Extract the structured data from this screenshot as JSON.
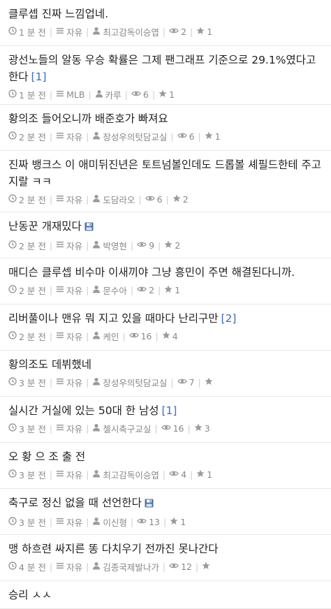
{
  "posts": [
    {
      "title": "클루셉 진짜 느낌업네.",
      "comments": "",
      "saved": false,
      "time": "1 분 전",
      "board": "자유",
      "author": "최고감독이승엽",
      "views": "2",
      "votes": "1",
      "h": 66
    },
    {
      "title": "광선노들의 알동 우승 확률은 그제 팬그래프 기준으로 29.1%였다고 한다",
      "comments": "[1]",
      "saved": false,
      "time": "1 분 전",
      "board": "MLB",
      "author": "카루",
      "views": "6",
      "votes": "1",
      "h": 84
    },
    {
      "title": "황의조 들어오니까 배준호가 빠져요",
      "comments": "",
      "saved": false,
      "time": "2 분 전",
      "board": "자유",
      "author": "장성우의텃담교실",
      "views": "6",
      "votes": "1",
      "h": 66
    },
    {
      "title": "진짜 뱅크스 이 애미뒤진년은 토트넘볼인데도 드롭볼 셰필드한테 주고 지랄 ㅋㅋ",
      "comments": "",
      "saved": false,
      "time": "2 분 전",
      "board": "자유",
      "author": "도담라오",
      "views": "6",
      "votes": "2",
      "h": 88
    },
    {
      "title": "난동꾼 개재밌다",
      "comments": "",
      "saved": true,
      "time": "2 분 전",
      "board": "자유",
      "author": "박영현",
      "views": "9",
      "votes": "2",
      "h": 66
    },
    {
      "title": "매디슨 클루셉 비수마 이새끼야 그냥 흥민이 주면 해결된다니까.",
      "comments": "",
      "saved": false,
      "time": "2 분 전",
      "board": "자유",
      "author": "문수아",
      "views": "2",
      "votes": "1",
      "h": 66
    },
    {
      "title": "리버풀이나 맨유 뭐 지고 있을 때마다 난리구만",
      "comments": "[2]",
      "saved": false,
      "time": "2 분 전",
      "board": "자유",
      "author": "케인",
      "views": "16",
      "votes": "4",
      "h": 66
    },
    {
      "title": "황의조도 데뷔했네",
      "comments": "",
      "saved": false,
      "time": "3 분 전",
      "board": "자유",
      "author": "장성우의텃담교실",
      "views": "7",
      "votes": "",
      "h": 66
    },
    {
      "title": "실시간 거실에 있는 50대 한 남성",
      "comments": "[1]",
      "saved": false,
      "time": "3 분 전",
      "board": "자유",
      "author": "첼시축구교실",
      "views": "16",
      "votes": "3",
      "h": 66
    },
    {
      "title": "오 황 으 조 출 전",
      "comments": "",
      "saved": false,
      "time": "3 분 전",
      "board": "자유",
      "author": "최고감독이승엽",
      "views": "4",
      "votes": "1",
      "h": 66
    },
    {
      "title": "축구로 정신 없을 때 선언한다",
      "comments": "",
      "saved": true,
      "time": "3 분 전",
      "board": "자유",
      "author": "이신형",
      "views": "13",
      "votes": "1",
      "h": 66
    },
    {
      "title": "맹 하흐련 싸지른 똥 다치우기 전까진 못나간다",
      "comments": "",
      "saved": false,
      "time": "4 분 전",
      "board": "자유",
      "author": "김종국제발나가",
      "views": "12",
      "votes": "",
      "h": 66
    },
    {
      "title": "승리 ㅅㅅ",
      "comments": "",
      "saved": false,
      "time": "",
      "board": "",
      "author": "",
      "views": "",
      "votes": "",
      "h": 40
    }
  ]
}
